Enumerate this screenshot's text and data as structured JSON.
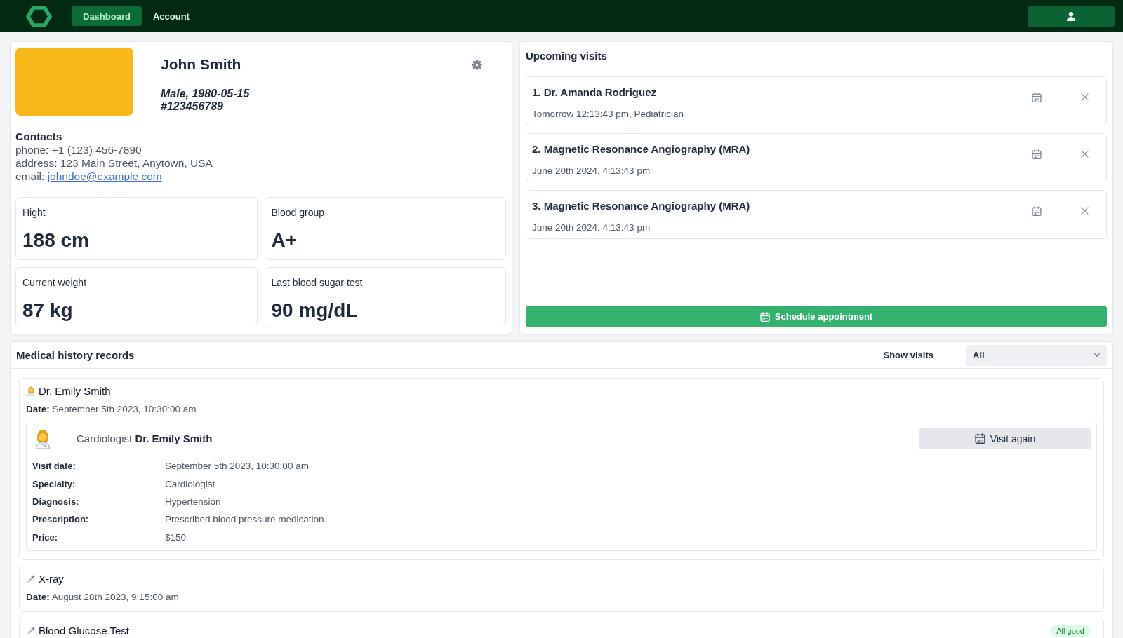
{
  "nav": {
    "tabs": [
      {
        "label": "Dashboard",
        "selected": true
      },
      {
        "label": "Account",
        "selected": false
      }
    ]
  },
  "profile": {
    "name": "John Smith",
    "details": [
      "Male, 1980-05-15",
      "#123456789"
    ],
    "contacts": {
      "title": "Contacts",
      "lines": [
        {
          "kind": "text",
          "label": "phone:",
          "value": "+1 (123) 456-7890"
        },
        {
          "kind": "text",
          "label": "address:",
          "value": "123 Main Street, Anytown, USA"
        },
        {
          "kind": "link",
          "label": "email:",
          "value": "johndoe@example.com"
        }
      ]
    },
    "stats": [
      {
        "label": "Hight",
        "value": "188 cm"
      },
      {
        "label": "Blood group",
        "value": "A+"
      },
      {
        "label": "Current weight",
        "value": "87 kg"
      },
      {
        "label": "Last blood sugar test",
        "value": "90 mg/dL"
      }
    ]
  },
  "upcoming_visits": {
    "title": "Upcoming visits",
    "items": [
      {
        "title": "1. Dr. Amanda Rodriguez",
        "subtitle": "Tomorrow 12:13:43 pm, Pediatrician"
      },
      {
        "title": "2. Magnetic Resonance Angiography (MRA)",
        "subtitle": "June 20th 2024, 4:13:43 pm"
      },
      {
        "title": "3. Magnetic Resonance Angiography (MRA)",
        "subtitle": "June 20th 2024, 4:13:43 pm"
      }
    ],
    "button": "Schedule appointment"
  },
  "medical_history": {
    "title": "Medical history records",
    "filter": {
      "label": "Show visits",
      "value": "All"
    },
    "records": [
      {
        "kind": "doctor",
        "title": "Dr. Emily Smith",
        "date": "**Date:** September 5th 2023, 10:30:00 am",
        "visit": {
          "heading": "Cardiologist **Dr. Emily Smith**",
          "button": "Visit again",
          "details": [
            {
              "label": "Visit date:",
              "value": "September 5th 2023, 10:30:00 am"
            },
            {
              "label": "Specialty:",
              "value": "Cardiologist"
            },
            {
              "label": "Diagnosis:",
              "value": "Hypertension"
            },
            {
              "label": "Prescription:",
              "value": "Prescribed blood pressure medication."
            },
            {
              "label": "Price:",
              "value": "$150"
            }
          ]
        }
      },
      {
        "kind": "test",
        "title": "X-ray",
        "date": "**Date:** August 28th 2023, 9:15:00 am"
      },
      {
        "kind": "test",
        "title": "Blood Glucose Test",
        "badge": "All good"
      }
    ]
  }
}
